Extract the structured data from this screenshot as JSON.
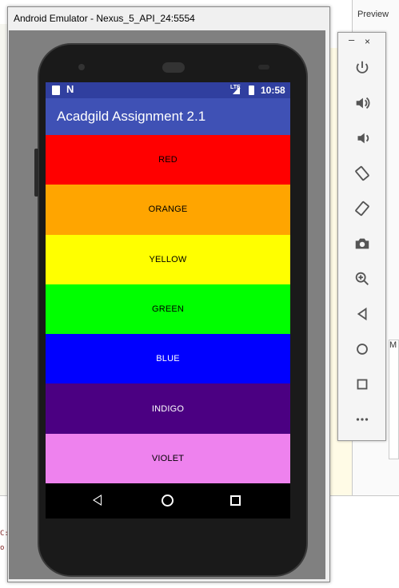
{
  "ide": {
    "preview_label": "Preview",
    "bottom_lines": [
      "C:",
      "o"
    ],
    "popup_text": "M"
  },
  "emulator": {
    "window_title": "Android Emulator - Nexus_5_API_24:5554"
  },
  "phone": {
    "status": {
      "time": "10:58",
      "network": "LTE",
      "notification": "N"
    },
    "app": {
      "title": "Acadgild Assignment 2.1"
    },
    "bands": [
      {
        "label": "RED",
        "bg": "#ff0000",
        "fg": "#000000"
      },
      {
        "label": "ORANGE",
        "bg": "#ffa500",
        "fg": "#000000"
      },
      {
        "label": "YELLOW",
        "bg": "#ffff00",
        "fg": "#000000"
      },
      {
        "label": "GREEN",
        "bg": "#00ff00",
        "fg": "#000000"
      },
      {
        "label": "BLUE",
        "bg": "#0000ff",
        "fg": "#ffffff"
      },
      {
        "label": "INDIGO",
        "bg": "#4b0082",
        "fg": "#ffffff"
      },
      {
        "label": "VIOLET",
        "bg": "#ee82ee",
        "fg": "#000000"
      }
    ],
    "colors": {
      "status_bar": "#303f9f",
      "app_bar": "#3f51b5"
    }
  },
  "toolbar": {
    "minimize_label": "–",
    "close_label": "×",
    "buttons": [
      {
        "icon": "power-icon"
      },
      {
        "icon": "volume-up-icon"
      },
      {
        "icon": "volume-down-icon"
      },
      {
        "icon": "rotate-left-icon"
      },
      {
        "icon": "rotate-right-icon"
      },
      {
        "icon": "camera-icon"
      },
      {
        "icon": "zoom-icon"
      },
      {
        "icon": "back-icon"
      },
      {
        "icon": "home-icon"
      },
      {
        "icon": "overview-icon"
      },
      {
        "icon": "more-icon"
      }
    ]
  }
}
